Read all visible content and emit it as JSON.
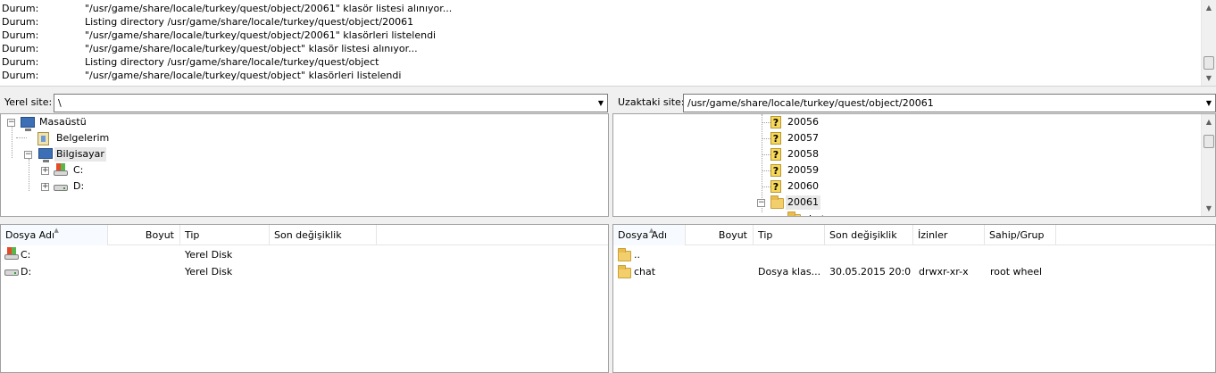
{
  "log": [
    {
      "label": "Durum:",
      "text": "\"/usr/game/share/locale/turkey/quest/object/20061\" klasör listesi alınıyor..."
    },
    {
      "label": "Durum:",
      "text": "Listing directory /usr/game/share/locale/turkey/quest/object/20061"
    },
    {
      "label": "Durum:",
      "text": "\"/usr/game/share/locale/turkey/quest/object/20061\" klasörleri listelendi"
    },
    {
      "label": "Durum:",
      "text": "\"/usr/game/share/locale/turkey/quest/object\" klasör listesi alınıyor..."
    },
    {
      "label": "Durum:",
      "text": "Listing directory /usr/game/share/locale/turkey/quest/object"
    },
    {
      "label": "Durum:",
      "text": "\"/usr/game/share/locale/turkey/quest/object\" klasörleri listelendi"
    }
  ],
  "local": {
    "site_label": "Yerel site:",
    "site_path": "\\",
    "tree": {
      "desktop": "Masaüstü",
      "documents": "Belgelerim",
      "computer": "Bilgisayar",
      "drive_c": "C:",
      "drive_d": "D:"
    },
    "columns": {
      "name": "Dosya Adı",
      "size": "Boyut",
      "type": "Tip",
      "modified": "Son değişiklik"
    },
    "rows": [
      {
        "name": "C:",
        "size": "",
        "type": "Yerel Disk",
        "modified": ""
      },
      {
        "name": "D:",
        "size": "",
        "type": "Yerel Disk",
        "modified": ""
      }
    ]
  },
  "remote": {
    "site_label": "Uzaktaki site:",
    "site_path": "/usr/game/share/locale/turkey/quest/object/20061",
    "tree": {
      "items": [
        "20056",
        "20057",
        "20058",
        "20059",
        "20060"
      ],
      "selected": "20061",
      "child": "chat"
    },
    "columns": {
      "name": "Dosya Adı",
      "size": "Boyut",
      "type": "Tip",
      "modified": "Son değişiklik",
      "perms": "İzinler",
      "owner": "Sahip/Grup"
    },
    "rows": [
      {
        "name": "..",
        "size": "",
        "type": "",
        "modified": "",
        "perms": "",
        "owner": ""
      },
      {
        "name": "chat",
        "size": "",
        "type": "Dosya klas...",
        "modified": "30.05.2015 20:0...",
        "perms": "drwxr-xr-x",
        "owner": "root wheel"
      }
    ]
  },
  "icons": {
    "folder": "folder-icon",
    "unknown_folder": "question-folder-icon",
    "desktop": "desktop-icon",
    "documents": "documents-icon",
    "computer": "computer-icon",
    "drive": "drive-icon"
  },
  "colors": {
    "folder": "#f3cf6b",
    "selected_bg": "#e8e8e8"
  }
}
